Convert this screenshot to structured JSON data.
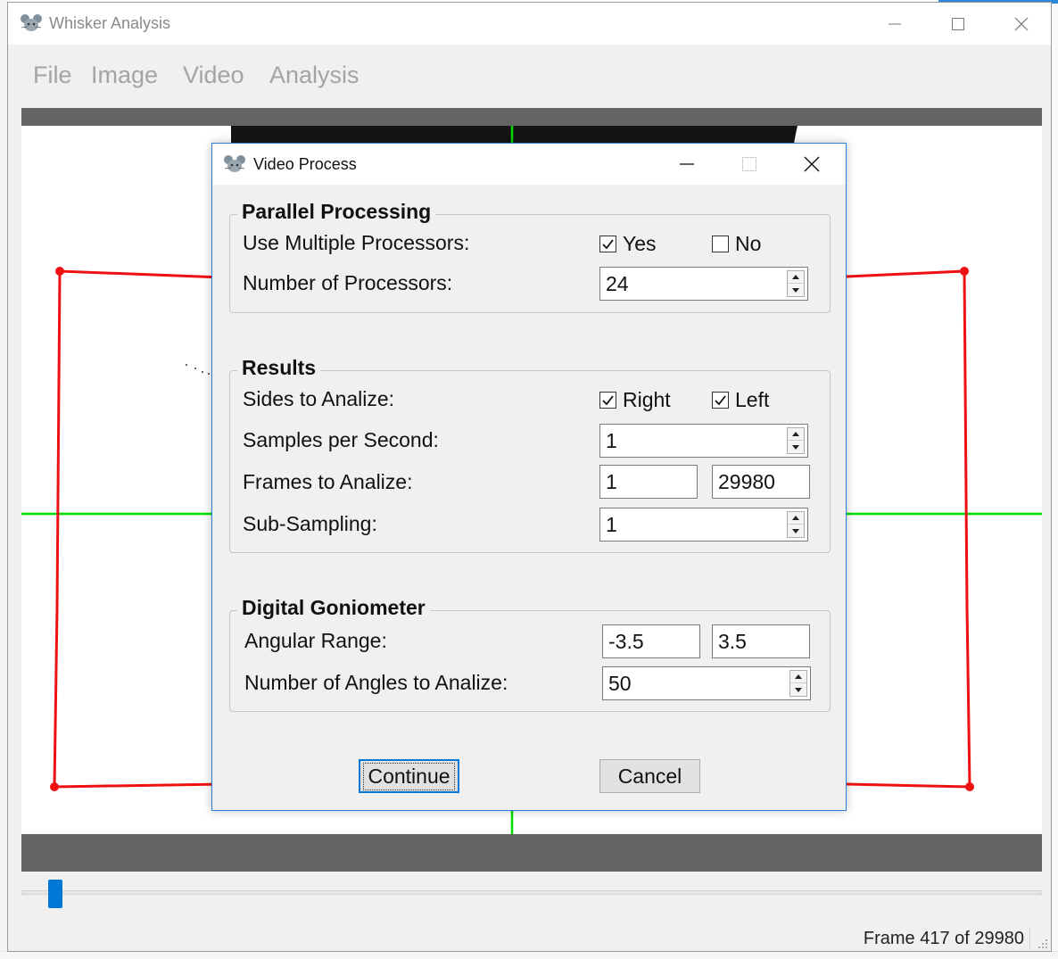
{
  "main_window": {
    "title": "Whisker Analysis",
    "menu": [
      "File",
      "Image",
      "Video",
      "Analysis"
    ],
    "status": "Frame 417 of 29980"
  },
  "colors": {
    "roi_red": "#ee1111",
    "crosshair_green": "#00dd00",
    "accent_blue": "#0078d7",
    "canvas_bar_gray": "#646464"
  },
  "icons": {
    "app": "mouse-icon",
    "minimize": "minimize-icon",
    "maximize": "maximize-icon",
    "close": "close-icon"
  },
  "slider": {
    "frame": 417,
    "total_frames": 29980
  },
  "dialog": {
    "title": "Video Process",
    "parallel": {
      "title": "Parallel Processing",
      "use_multiple_label": "Use Multiple Processors:",
      "yes_label": "Yes",
      "yes_checked": true,
      "no_label": "No",
      "no_checked": false,
      "num_processors_label": "Number of Processors:",
      "num_processors": "24"
    },
    "results": {
      "title": "Results",
      "sides_label": "Sides to Analize:",
      "right_label": "Right",
      "right_checked": true,
      "left_label": "Left",
      "left_checked": true,
      "samples_label": "Samples per Second:",
      "samples": "1",
      "frames_label": "Frames to Analize:",
      "frames_start": "1",
      "frames_end": "29980",
      "subsampling_label": "Sub-Sampling:",
      "subsampling": "1"
    },
    "goniometer": {
      "title": "Digital Goniometer",
      "range_label": "Angular Range:",
      "range_min": "-3.5",
      "range_max": "3.5",
      "angles_label": "Number of Angles to Analize:",
      "angles": "50"
    },
    "continue_label": "Continue",
    "cancel_label": "Cancel"
  }
}
